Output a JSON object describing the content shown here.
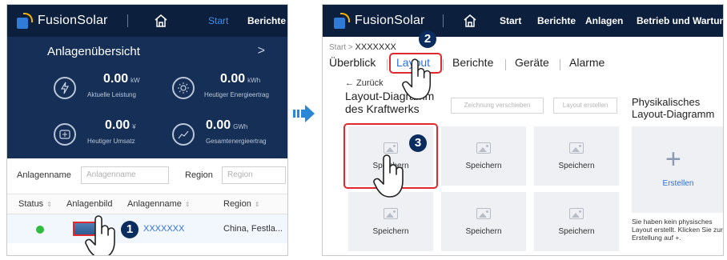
{
  "left_panel": {
    "app": {
      "logo_text": "FusionSolar",
      "nav": [
        "Start",
        "Berichte"
      ]
    },
    "overview": {
      "title": "Anlagenübersicht",
      "more": ">",
      "metrics": [
        {
          "value": "0.00",
          "unit": "kW",
          "label": "Aktuelle Leistung",
          "icon": "lightning-icon"
        },
        {
          "value": "0.00",
          "unit": "kWh",
          "label": "Heutiger Energieertrag",
          "icon": "sun-icon"
        },
        {
          "value": "0.00",
          "unit": "¥",
          "label": "Heutiger Umsatz",
          "icon": "money-icon"
        },
        {
          "value": "0.00",
          "unit": "GWh",
          "label": "Gesamtenergieertrag",
          "icon": "chart-icon"
        }
      ]
    },
    "filters": {
      "plant_name_label": "Anlagenname",
      "plant_name_placeholder": "Anlagenname",
      "region_label": "Region",
      "region_placeholder": "Region"
    },
    "table": {
      "columns": [
        "Status",
        "Anlagenbild",
        "Anlagenname",
        "Region"
      ],
      "row": {
        "status_color": "#2ebd3f",
        "name": "XXXXXXX",
        "region": "China, Festla..."
      }
    },
    "step_badge": "1"
  },
  "right_panel": {
    "app": {
      "logo_text": "FusionSolar",
      "nav": [
        "Start",
        "Berichte",
        "Anlagen",
        "Betrieb und Wartung"
      ]
    },
    "breadcrumb": {
      "root": "Start",
      "sep": ">",
      "current": "XXXXXXX"
    },
    "tabs": [
      "Überblick",
      "Layout",
      "Berichte",
      "Geräte",
      "Alarme"
    ],
    "active_tab": "Layout",
    "back_label": "← Zurück",
    "canvas_title_line1": "Layout-Diagramm",
    "canvas_title_line2": "des Kraftwerks",
    "buttons": {
      "move": "Zeichnung verschieben",
      "create_layout": "Layout erstellen"
    },
    "tiles": [
      "Speichern",
      "Speichern",
      "Speichern",
      "Speichern",
      "Speichern",
      "Speichern"
    ],
    "physical": {
      "title_line1": "Physikalisches",
      "title_line2": "Layout-Diagramm",
      "create_label": "Erstellen",
      "hint": "Sie haben kein physisches Layout erstellt. Klicken Sie zur Erstellung auf +."
    },
    "step_badges": [
      "2",
      "3"
    ]
  },
  "colors": {
    "topbar": "#0c1f3d",
    "hero": "#162f57",
    "accent": "#2f6fd6",
    "highlight": "#e0282e",
    "badge": "#0a2c5e",
    "arrow": "#2b86d6"
  }
}
